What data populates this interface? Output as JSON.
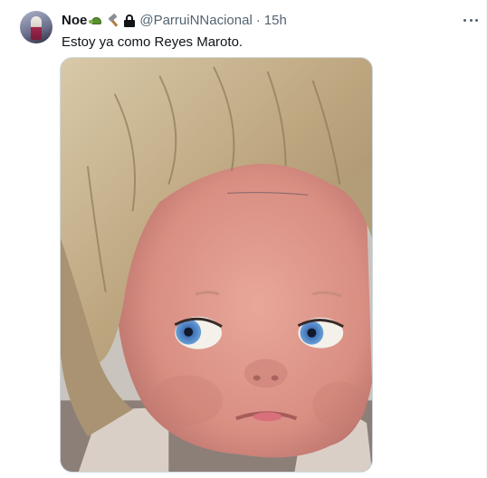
{
  "tweet": {
    "author_name": "Noe",
    "author_emojis": [
      "turtle-icon",
      "hammer-icon"
    ],
    "protected_icon": "lock-icon",
    "author_handle": "@ParruiNNacional",
    "separator": "·",
    "timestamp": "15h",
    "text": "Estoy ya como Reyes Maroto.",
    "more_icon": "more-options-icon",
    "media": {
      "type": "photo",
      "alt": ""
    }
  },
  "colors": {
    "text_primary": "#0f1419",
    "text_secondary": "#536471",
    "border": "#cfd9de"
  }
}
